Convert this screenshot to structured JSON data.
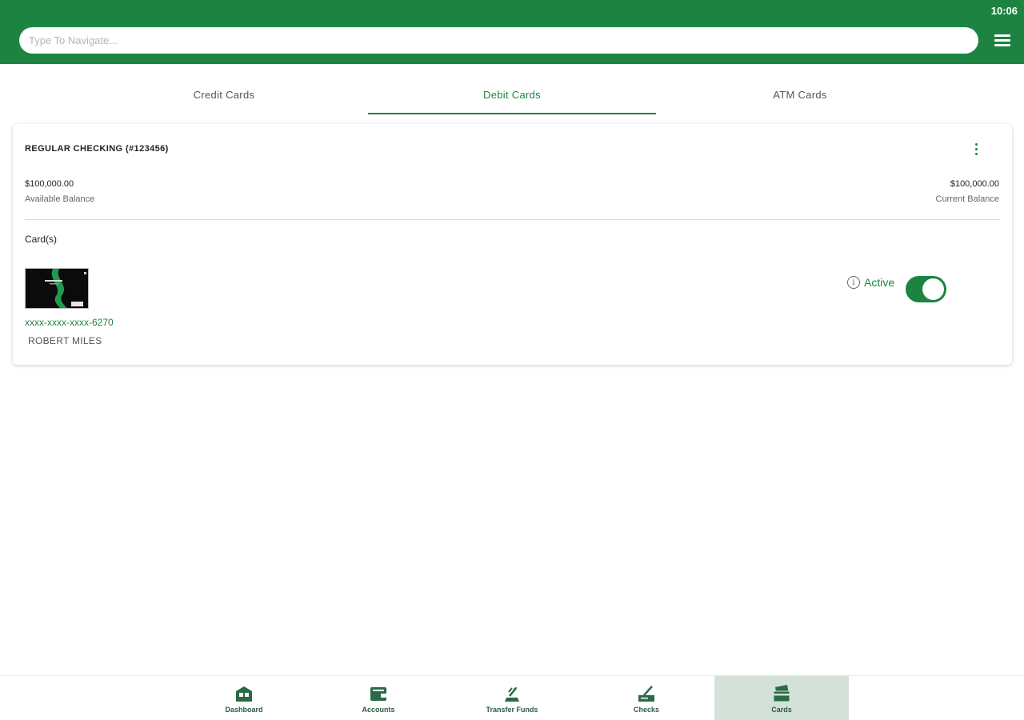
{
  "status_bar": {
    "time": "10:06"
  },
  "header": {
    "search_placeholder": "Type To Navigate...",
    "menu_icon": "hamburger-menu-icon",
    "accent_color": "#1c8440"
  },
  "tabs": [
    {
      "label": "Credit Cards",
      "active": false
    },
    {
      "label": "Debit Cards",
      "active": true
    },
    {
      "label": "ATM Cards",
      "active": false
    }
  ],
  "account": {
    "title": "REGULAR CHECKING (#123456)",
    "available_balance": "$100,000.00",
    "available_label": "Available Balance",
    "current_balance": "$100,000.00",
    "current_label": "Current Balance",
    "cards_label": "Card(s)",
    "more_icon": "kebab-menu-icon"
  },
  "card": {
    "number": "xxxx-xxxx-xxxx-6270",
    "holder": "ROBERT MILES",
    "status": "Active",
    "enabled": true,
    "info_icon": "info-icon"
  },
  "bottom_nav": [
    {
      "label": "Dashboard",
      "icon": "dashboard-icon",
      "active": false
    },
    {
      "label": "Accounts",
      "icon": "wallet-icon",
      "active": false
    },
    {
      "label": "Transfer Funds",
      "icon": "transfer-icon",
      "active": false
    },
    {
      "label": "Checks",
      "icon": "check-icon",
      "active": false
    },
    {
      "label": "Cards",
      "icon": "card-icon",
      "active": true
    }
  ]
}
